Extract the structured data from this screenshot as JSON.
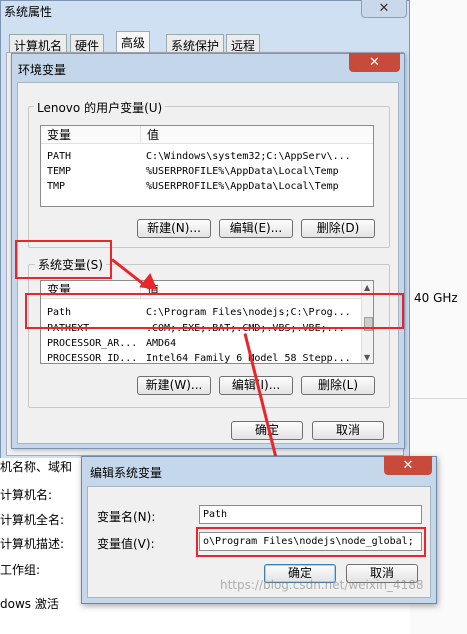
{
  "system_properties": {
    "title": "系统属性",
    "close_symbol": "✕",
    "tabs": [
      "计算机名",
      "硬件",
      "高级",
      "系统保护",
      "远程"
    ],
    "side_labels": [
      "机名称、域和",
      "计算机名:",
      "计算机全名:",
      "计算机描述:",
      "工作组:",
      "dows 激活"
    ],
    "cpu_speed_fragment": "40 GHz"
  },
  "env_dialog": {
    "title": "环境变量",
    "close_symbol": "✕",
    "user_group_label": "Lenovo 的用户变量(U)",
    "user_columns": [
      "变量",
      "值"
    ],
    "user_vars": [
      {
        "name": "PATH",
        "value": "C:\\Windows\\system32;C:\\AppServ\\..."
      },
      {
        "name": "TEMP",
        "value": "%USERPROFILE%\\AppData\\Local\\Temp"
      },
      {
        "name": "TMP",
        "value": "%USERPROFILE%\\AppData\\Local\\Temp"
      }
    ],
    "user_buttons": [
      "新建(N)...",
      "编辑(E)...",
      "删除(D)"
    ],
    "sys_group_label": "系统变量(S)",
    "sys_columns": [
      "变量",
      "值"
    ],
    "sys_vars": [
      {
        "name": "Path",
        "value": "C:\\Program Files\\nodejs;C:\\Prog..."
      },
      {
        "name": "PATHEXT",
        "value": ".COM;.EXE;.BAT;.CMD;.VBS;.VBE;..."
      },
      {
        "name": "PROCESSOR_AR...",
        "value": "AMD64"
      },
      {
        "name": "PROCESSOR_ID...",
        "value": "Intel64 Family 6 Model 58 Stepp..."
      }
    ],
    "sys_buttons": [
      "新建(W)...",
      "编辑(I)...",
      "删除(L)"
    ],
    "ok_label": "确定",
    "cancel_label": "取消"
  },
  "edit_dialog": {
    "title": "编辑系统变量",
    "close_symbol": "✕",
    "name_label": "变量名(N):",
    "name_value": "Path",
    "value_label": "变量值(V):",
    "value_value": "o\\Program Files\\nodejs\\node_global;",
    "ok_label": "确定",
    "cancel_label": "取消"
  },
  "watermark": "https://blog.csdn.net/weixin_4188",
  "colors": {
    "annotation_red": "#e8262b",
    "window_frame": "#c3d6ea",
    "close_red": "#c84a3a"
  }
}
